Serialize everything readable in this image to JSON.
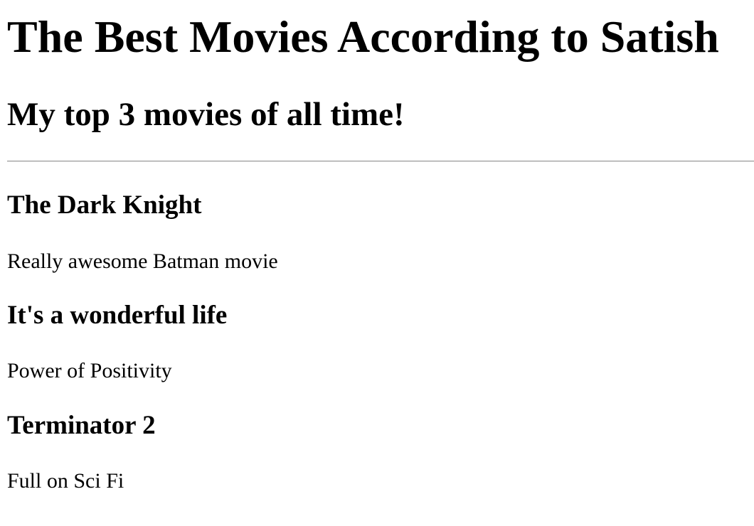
{
  "header": {
    "title": "The Best Movies According to Satish",
    "subtitle": "My top 3 movies of all time!"
  },
  "movies": [
    {
      "title": "The Dark Knight",
      "description": "Really awesome Batman movie"
    },
    {
      "title": "It's a wonderful life",
      "description": "Power of Positivity"
    },
    {
      "title": "Terminator 2",
      "description": "Full on Sci Fi"
    }
  ]
}
